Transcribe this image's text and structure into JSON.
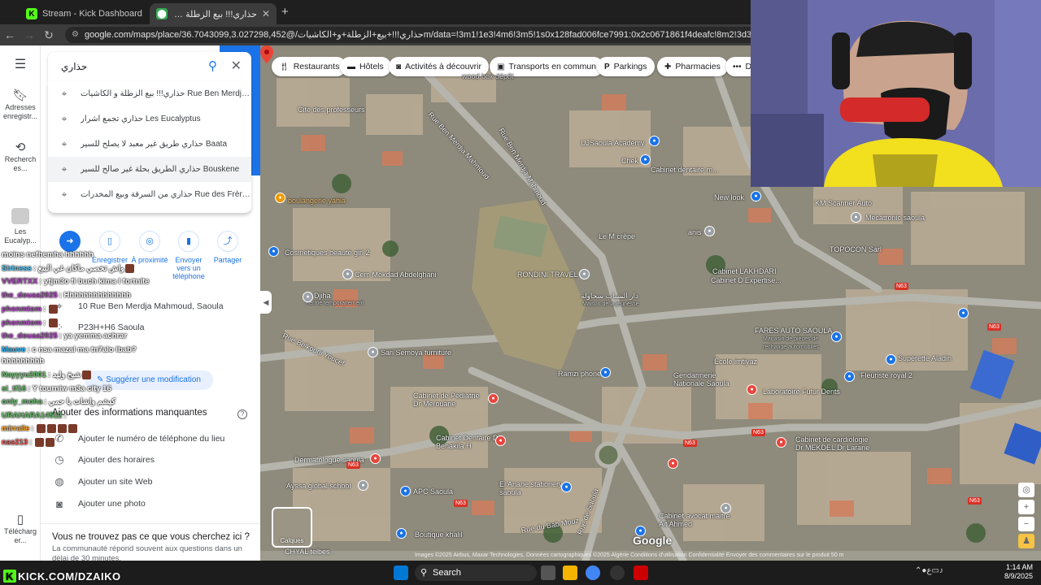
{
  "browser": {
    "tabs": [
      {
        "title": "Stream - Kick Dashboard",
        "active": false
      },
      {
        "title": "حذاري!!! بيع الزطلة و الكاشيات - ...",
        "active": true
      }
    ],
    "new_tab": "+",
    "url": "google.com/maps/place/حذاري!!!+بيع+الزطلة+و+الكاشيات/@36.7043099,3.027298,452m/data=!3m1!1e3!4m6!3m5!1s0x128fad006fce7991:0x2c0671861f4deafc!8m2!3d36.7039589!4d3.02"
  },
  "rail": {
    "menu_icon": "menu-icon",
    "saved": "Adresses enregistr...",
    "recent": "Recherch es...",
    "place": "Les Eucalyp...",
    "download": "Télécharg er..."
  },
  "search": {
    "query": "حذاري",
    "suggestions": [
      {
        "text": "حذاري!!! بيع الزطلة و الكاشيات Rue Ben Merdja Mahm..."
      },
      {
        "text": "حذاري تجمع اشرار Les Eucalyptus"
      },
      {
        "text": "حذاري طريق غير معبد لا يصلح للسير Baata"
      },
      {
        "text": "حذاري الطريق بحلة غير صالح للسير Bouskene"
      },
      {
        "text": "حذاري من السرقة وبيع المخدرات Rue des Frères Mans..."
      }
    ]
  },
  "actions": [
    {
      "label": "Itinéraire",
      "icon": "directions-icon"
    },
    {
      "label": "Enregistrer",
      "icon": "bookmark-icon"
    },
    {
      "label": "À proximité",
      "icon": "nearby-icon"
    },
    {
      "label": "Envoyer vers un téléphone",
      "icon": "phone-send-icon"
    },
    {
      "label": "Partager",
      "icon": "share-icon"
    }
  ],
  "place_info": {
    "address": "10 Rue Ben Merdja Mahmoud, Saoula",
    "plus_code": "P23H+H6 Saoula",
    "suggest_edit": "Suggérer une modification",
    "missing_title": "Ajouter des informations manquantes",
    "missing": [
      {
        "label": "Ajouter le numéro de téléphone du lieu",
        "icon": "phone-icon"
      },
      {
        "label": "Ajouter des horaires",
        "icon": "clock-icon"
      },
      {
        "label": "Ajouter un site Web",
        "icon": "globe-icon"
      },
      {
        "label": "Ajouter une photo",
        "icon": "camera-icon"
      }
    ],
    "not_found": "Vous ne trouvez pas ce que vous cherchez ici ?",
    "not_found_sub": "La communauté répond souvent aux questions dans un délai de 30 minutes."
  },
  "chat": [
    {
      "user": "",
      "msg": "moins nefhemha hhhhhh"
    },
    {
      "user": "Siriness",
      "msg": "واش تخصي ماكان غي البنغ",
      "color": "#4fc3f7"
    },
    {
      "user": "VVERTXX",
      "msg": "ytjm3o fi buch kima l fortnite",
      "color": "#ab47bc"
    },
    {
      "user": "the_douaa2025",
      "msg": "Hhhhhhhhhhhhhh",
      "color": "#ab47bc"
    },
    {
      "user": "phonmtom",
      "msg": "",
      "color": "#ab47bc"
    },
    {
      "user": "phonmtom",
      "msg": "",
      "color": "#ab47bc"
    },
    {
      "user": "the_douaa2025",
      "msg": "ya yemma achrar",
      "color": "#ab47bc"
    },
    {
      "user": "Mauve",
      "msg": "c nsa mazal ma tn7alo lbab?",
      "color": "#29b6f6"
    },
    {
      "user": "",
      "msg": "hhhhhhhhh"
    },
    {
      "user": "Nayyyu2001",
      "msg": "شيخ وليد",
      "color": "#66bb6a"
    },
    {
      "user": "si_tf16",
      "msg": "Y tourniw m3a city 16",
      "color": "#66bb6a"
    },
    {
      "user": "only_moha",
      "msg": "كيشم واشات يا حمي",
      "color": "#66bb6a"
    },
    {
      "user": "URAHARA14512",
      "msg": "",
      "color": "#66bb6a"
    },
    {
      "user": "mirraile",
      "msg": "",
      "color": "#ffa726"
    },
    {
      "user": "nas213",
      "msg": "",
      "color": "#ef5350"
    }
  ],
  "map": {
    "chips": [
      {
        "label": "Restaurants",
        "icon": "restaurant-icon"
      },
      {
        "label": "Hôtels",
        "icon": "hotel-icon"
      },
      {
        "label": "Activités à découvrir",
        "icon": "camera-icon"
      },
      {
        "label": "Transports en commun",
        "icon": "transit-icon"
      },
      {
        "label": "Parkings",
        "icon": "parking-icon"
      },
      {
        "label": "Pharmacies",
        "icon": "pharmacy-icon"
      },
      {
        "label": "Di",
        "icon": "more-icon"
      }
    ],
    "labels": {
      "cite": "Cité des professeurs",
      "street1": "Rue Ben Merdja Mahmoud",
      "street2": "Rue Ben Merdja Mahmoud",
      "uj": "UJSaoula Academy",
      "chek": "Chek",
      "dentaire": "Cabinet dentaire m...",
      "boulangerie": "boulangerie yahia",
      "newlook": "New look",
      "km": "KM Scanner Auto",
      "mecatronic": "Mécatronic saoula",
      "topocon": "TOPOCON Sarl",
      "crepe": "Le M crêpe",
      "anis": "anis",
      "cosmetiques": "Cosmétiques beauté girl 2",
      "cem": "Cem Mokdad Abdelghani",
      "rondini": "RONDINI TRAVEL",
      "lakhdari": "Cabinet LAKHDARI",
      "expertise": "Cabinet D'Expertise...",
      "djiha": "Djiha",
      "djiha_sub": "Fermé temporairement",
      "maison": "دار الشباب سحاولة",
      "maison_sub": "Maison de la jeunesse",
      "fares": "FARES AUTO SAOULA",
      "fares_sub": "Magasin de pièces de rechange automobiles",
      "belkouni": "Rue Belkouni Youcef",
      "sari": "Sari Semoya furniture",
      "ramzi": "Ramzi phone",
      "ecole": "École imtiyaz",
      "gendarmerie": "Gendarmerie Nationale Saoula",
      "superette": "Supérette Aladin",
      "fleuriste": "Fleuriste royal 2",
      "pediatrie": "Cabinet de Pédiatrie Dr Merouane",
      "laboratoire": "Laboratoire Futur Dents",
      "cardio": "Cabinet de cardiologie Dr MEKDEL Dr Larane",
      "benakila": "Cabinet Dentaire Dr Benakila H",
      "dermato": "Dermatologue saoula",
      "apc": "APC Saoula",
      "elanane": "El Anane stationery saoula",
      "aysa": "Ayssa global school",
      "rue_saoula": "Rue de Saoula",
      "bab_mouz": "Rue du Bab Mouz",
      "boutique": "Boutique khalil",
      "avocat": "Cabinet avocat maitre Ait Ahmed",
      "tebes": "CHYAL telbes",
      "depot": "wood box dépôt"
    },
    "roads": [
      "N63",
      "N63",
      "N63",
      "N63",
      "N63",
      "N63",
      "N63"
    ],
    "layers": "Calques",
    "logo": "Google",
    "attribution": "Images ©2025 Airbus, Maxar Technologies, Données cartographiques ©2025   Algérie   Conditions d'utilisation   Confidentialité   Envoyer des commentaires sur le produit   50 m"
  },
  "taskbar": {
    "kick": "KICK.COM/DZAIKO",
    "search": "Search",
    "time": "1:14 AM",
    "date": "8/9/2025",
    "lang": "ع"
  }
}
